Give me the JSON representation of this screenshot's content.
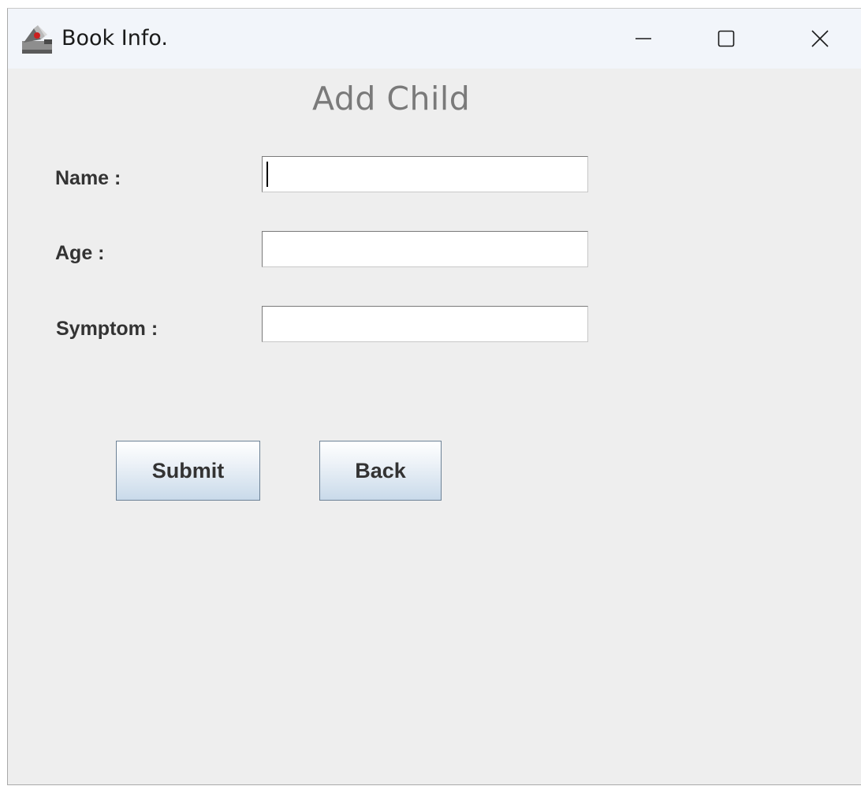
{
  "window": {
    "title": "Book Info.",
    "icon": "java-app-icon",
    "controls": {
      "minimize": "minimize-icon",
      "maximize": "maximize-icon",
      "close": "close-icon"
    }
  },
  "form": {
    "heading": "Add Child",
    "fields": [
      {
        "label": "Name :",
        "value": ""
      },
      {
        "label": "Age :",
        "value": ""
      },
      {
        "label": "Symptom :",
        "value": ""
      }
    ],
    "buttons": {
      "submit": "Submit",
      "back": "Back"
    }
  },
  "colors": {
    "window_background": "#eeeeee",
    "titlebar_background": "#f2f5fa",
    "heading_text": "#7a7a7a",
    "label_text": "#333333",
    "button_gradient_bottom": "#c9daea",
    "button_border": "#6d8296"
  }
}
